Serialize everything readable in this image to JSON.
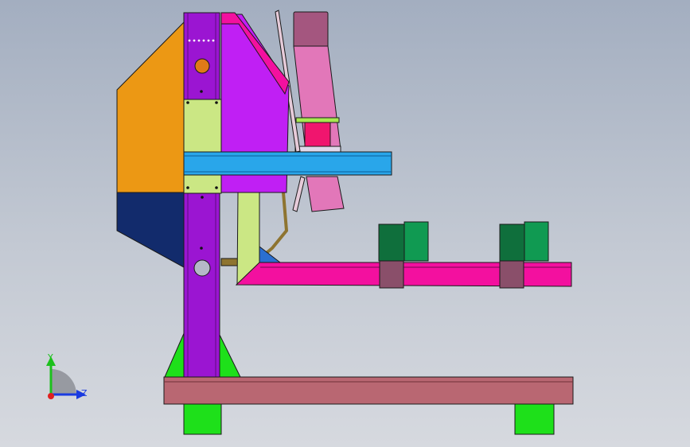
{
  "viewport": {
    "background_top": "#a3aec0",
    "background_bottom": "#d6d9df"
  },
  "model": {
    "colors": {
      "orange_panel": "#ec9814",
      "navy_panel": "#122b6c",
      "purple_column": "#9b15d2",
      "magenta_plate": "#c01ff4",
      "pink_arm": "#f3109f",
      "pink_cylinder": "#e277b9",
      "cyan_beam": "#29a6ea",
      "lime_plate": "#cbe784",
      "base_beam": "#b96772",
      "green_foot": "#1ee01a",
      "dark_green_block": "#0f6f3c",
      "green_block": "#109a52",
      "olive_rod": "#8e7430"
    }
  },
  "triad": {
    "y_label": "Y",
    "z_label": "Z",
    "y_color": "#1cc01c",
    "z_color": "#1a3be0",
    "x_color": "#e02020"
  }
}
